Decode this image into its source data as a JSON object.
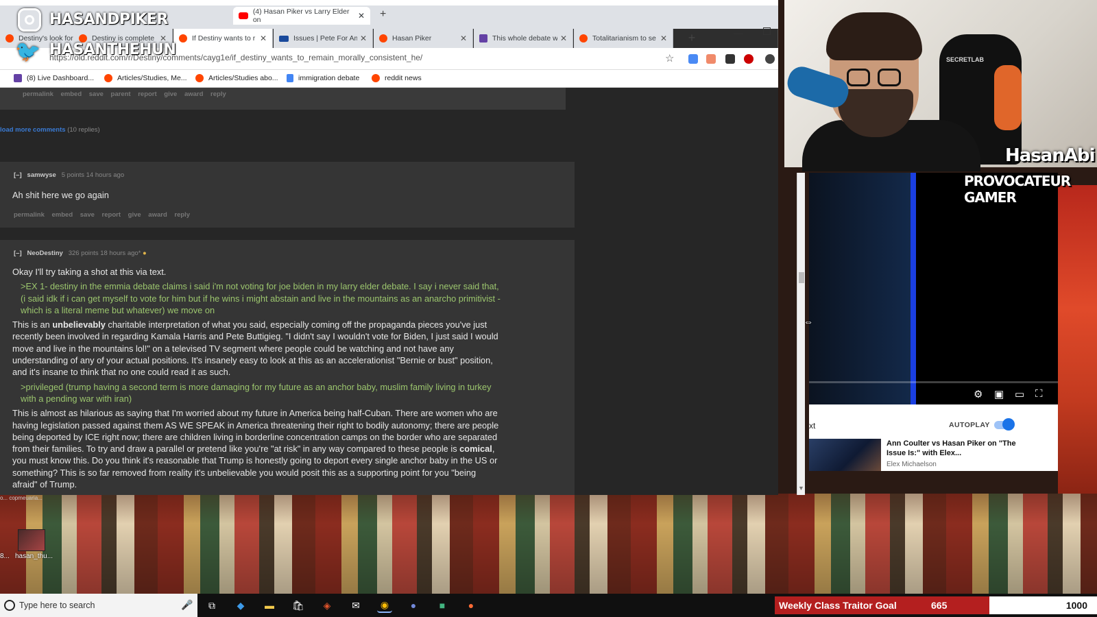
{
  "overlay": {
    "instagram": "HASANDPIKER",
    "twitter": "HASANTHEHUN",
    "streamer_name": "HasanAbi",
    "streamer_title": "PROVOCATEUR GAMER",
    "chair_brand": "SECRETLAB"
  },
  "browser": {
    "youtube_tab": "(4) Hasan Piker vs Larry Elder on",
    "tabs": [
      {
        "label": "Destiny's look for fu",
        "icon": "reddit-icon"
      },
      {
        "label": "Destiny is complete",
        "icon": "reddit-icon"
      },
      {
        "label": "If Destiny wants to r",
        "icon": "reddit-icon",
        "active": true
      },
      {
        "label": "Issues | Pete For Am",
        "icon": "site-icon"
      },
      {
        "label": "Hasan Piker",
        "icon": "reddit-icon"
      },
      {
        "label": "This whole debate w",
        "icon": "twitch-icon"
      },
      {
        "label": "Totalitarianism to se",
        "icon": "reddit-icon"
      }
    ],
    "url": "https://old.reddit.com/r/Destiny/comments/cayg1e/if_destiny_wants_to_remain_morally_consistent_he/",
    "bookmarks": [
      {
        "label": "(8) Live Dashboard...",
        "icon": "twitch-icon"
      },
      {
        "label": "Articles/Studies, Me...",
        "icon": "reddit-icon"
      },
      {
        "label": "Articles/Studies abo...",
        "icon": "reddit-icon"
      },
      {
        "label": "immigration debate",
        "icon": "doc-icon"
      },
      {
        "label": "reddit news",
        "icon": "reddit-icon"
      }
    ]
  },
  "reddit": {
    "prev_actions": "permalink embed save parent report give award reply",
    "load_more": "load more comments",
    "load_more_count": "(10 replies)",
    "comment1": {
      "collapse": "[–]",
      "author": "samwyse",
      "meta": "5 points 14 hours ago",
      "body": "Ah shit here we go again",
      "actions": "permalink embed save report give award reply"
    },
    "comment2": {
      "collapse": "[–]",
      "author": "NeoDestiny",
      "meta": "326 points 18 hours ago*",
      "p1": "Okay I'll try taking a shot at this via text.",
      "q1": ">EX 1- destiny in the emmia debate claims i said i'm not voting for joe biden in my larry elder debate. I say i never said that, (i said idk if i can get myself to vote for him but if he wins i might abstain and live in the mountains as an anarcho primitivist - which is a literal meme but whatever) we move on",
      "p2_pre": "This is an ",
      "p2_bold": "unbelievably",
      "p2_post": " charitable interpretation of what you said, especially coming off the propaganda pieces you've just recently been involved in regarding Kamala Harris and Pete Buttigieg. \"I didn't say I wouldn't vote for Biden, I just said I would move and live in the mountains lol!\" on a televised TV segment where people could be watching and not have any understanding of any of your actual positions. It's insanely easy to look at this as an accelerationist \"Bernie or bust\" position, and it's insane to think that no one could read it as such.",
      "q2": ">privileged (trump having a second term is more damaging for my future as an anchor baby, muslim family living in turkey with a pending war with iran)",
      "p3_pre": "This is almost as hilarious as saying that I'm worried about my future in America being half-Cuban. There are women who are having legislation passed against them AS WE SPEAK in America threatening their right to bodily autonomy; there are people being deported by ICE right now; there are children living in borderline concentration camps on the border who are separated from their families. To try and draw a parallel or pretend like you're \"at risk\" in any way compared to these people is ",
      "p3_bold": "comical",
      "p3_post": ", you must know this. Do you think it's reasonable that Trump is honestly going to deport every single anchor baby in the US or something? This is so far removed from reality it's unbelievable you would posit this as a supporting point for you \"being afraid\" of Trump."
    }
  },
  "youtube_popout": {
    "upnext": "xt",
    "autoplay": "AUTOPLAY",
    "next_title": "Ann Coulter vs Hasan Piker on \"The Issue Is:\" with Elex...",
    "next_channel": "Elex Michaelson"
  },
  "desktop": {
    "mini_label": "hasan_thu...",
    "mini_label2": "8...",
    "strip_label": "o...  copmeuaria..."
  },
  "taskbar": {
    "search_placeholder": "Type here to search",
    "goal_label": "Weekly Class Traitor Goal",
    "goal_current": "665",
    "goal_target": "1000",
    "goal_progress": 0.665
  }
}
